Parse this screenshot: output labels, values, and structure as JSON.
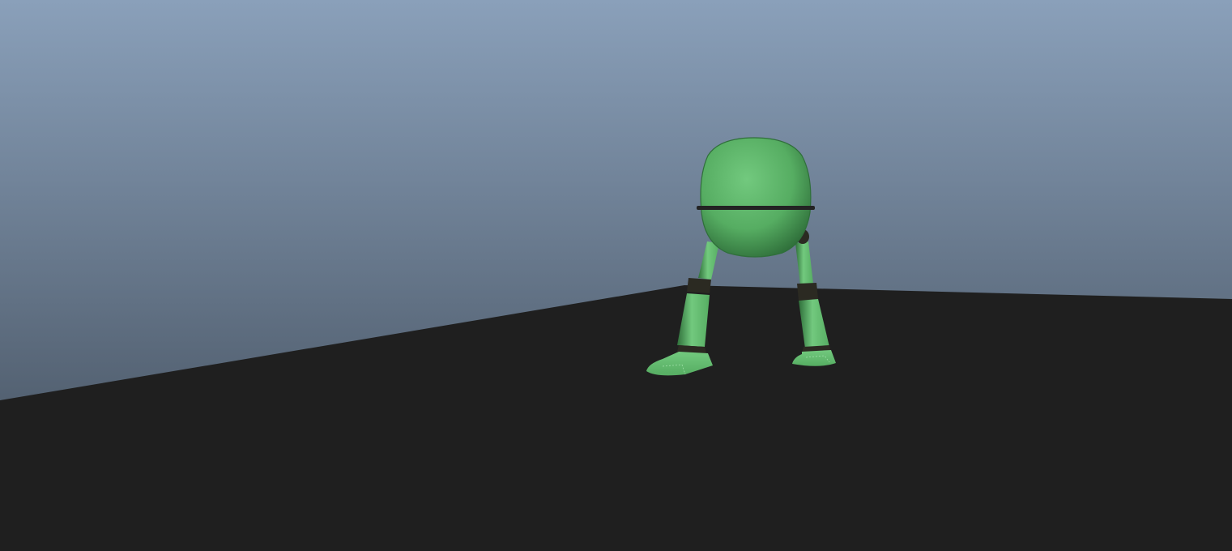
{
  "viewport": {
    "type": "3d-viewport",
    "colors": {
      "sky_top": "#8aa0ba",
      "sky_bottom": "#3f4a57",
      "ground": "#1f1f1f",
      "body_light": "#72c97e",
      "body_mid": "#56ad62",
      "body_dark": "#2f6f3a",
      "joint": "#2b2a22",
      "waist_band": "#232323"
    },
    "objects": {
      "ground_plane": "ground-plane",
      "character": "green-biped-robot"
    }
  }
}
